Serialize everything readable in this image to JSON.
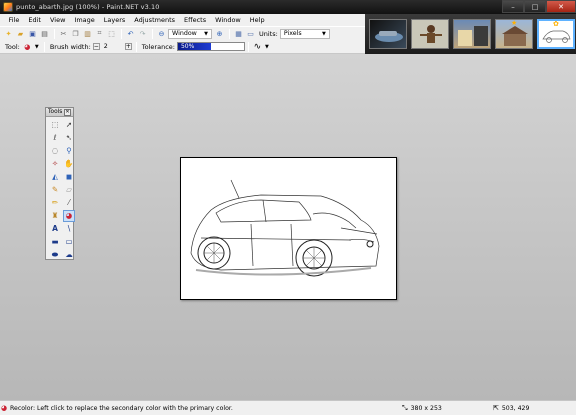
{
  "window": {
    "title": "punto_abarth.jpg (100%) - Paint.NET v3.10",
    "minimize": "–",
    "maximize": "□",
    "close": "✕"
  },
  "menu": [
    "File",
    "Edit",
    "View",
    "Image",
    "Layers",
    "Adjustments",
    "Effects",
    "Window",
    "Help"
  ],
  "toolbar": {
    "window_dropdown": "Window",
    "units_label": "Units:",
    "units_value": "Pixels"
  },
  "tool_options": {
    "tool_label": "Tool:",
    "brush_width_label": "Brush width:",
    "brush_width_value": "2",
    "tolerance_label": "Tolerance:",
    "tolerance_value": "50%",
    "tolerance_fraction": 0.5
  },
  "tools_panel": {
    "title": "Tools",
    "tools": [
      "rectangle-select-icon",
      "move-selection-icon",
      "lasso-select-icon",
      "move-selection-outline-icon",
      "ellipse-select-icon",
      "zoom-icon",
      "magic-wand-icon",
      "pan-icon",
      "paint-bucket-icon",
      "gradient-icon",
      "paintbrush-icon",
      "eraser-icon",
      "pencil-icon",
      "color-picker-icon",
      "clone-stamp-icon",
      "recolor-icon",
      "text-icon",
      "line-curve-icon",
      "rectangle-icon",
      "rounded-rectangle-icon",
      "ellipse-icon",
      "freeform-shape-icon"
    ],
    "selected_index": 15
  },
  "status": {
    "message": "Recolor: Left click to replace the secondary color with the primary color.",
    "image_size": "380 x 253",
    "cursor_position": "503, 429"
  },
  "colors": {
    "title_bar": "#1a1a1a",
    "selected_thumb_border": "#5fb2ff",
    "tolerance_fill": "#1d3bd2"
  }
}
